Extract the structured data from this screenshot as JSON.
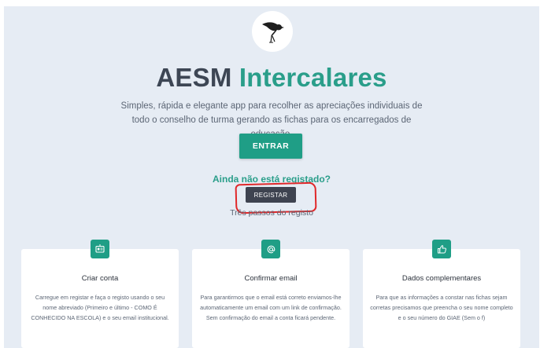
{
  "hero": {
    "title_main": "AESM",
    "title_accent": "Intercalares",
    "subtitle": "Simples, rápida e elegante app para recolher as apreciações individuais de todo o conselho de turma gerando as fichas para os encarregados de educação."
  },
  "actions": {
    "enter_label": "ENTRAR",
    "not_registered_text": "Ainda não está registado?",
    "register_label": "REGISTAR",
    "steps_label": "Três passos do registo"
  },
  "steps": [
    {
      "icon": "id-card-icon",
      "title": "Criar conta",
      "text": "Carregue em registar e faça o registo usando o seu nome abreviado (Primeiro e último - COMO É CONHECIDO NA ESCOLA) e o seu email institucional."
    },
    {
      "icon": "at-sign-icon",
      "title": "Confirmar email",
      "text": "Para garantirmos que o email está correto enviamos-lhe automaticamente um email com um link de confirmação. Sem confirmação do email a conta ficará pendente."
    },
    {
      "icon": "thumbs-up-icon",
      "title": "Dados complementares",
      "text": "Para que as informações a constar nas fichas sejam corretas precisamos que preencha o seu nome completo e o seu número do GIAE (Sem o f)"
    }
  ],
  "colors": {
    "accent": "#1f9e86",
    "background": "#e6ecf4",
    "register_button": "#3e4350",
    "annotation": "#e0282a"
  }
}
